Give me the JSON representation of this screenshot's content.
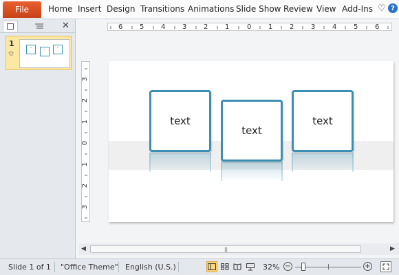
{
  "ribbon": {
    "file_label": "File",
    "tabs": [
      "Home",
      "Insert",
      "Design",
      "Transitions",
      "Animations",
      "Slide Show",
      "Review",
      "View",
      "Add-Ins"
    ],
    "help_label": "?"
  },
  "left_panel": {
    "slide_number": "1",
    "mini_box_glyph": "˅"
  },
  "ruler": {
    "horizontal": [
      "6",
      "5",
      "4",
      "3",
      "2",
      "1",
      "0",
      "1",
      "2",
      "3",
      "4",
      "5",
      "6"
    ],
    "vertical": [
      "3",
      "2",
      "1",
      "0",
      "1",
      "2",
      "3"
    ]
  },
  "slide": {
    "boxes": [
      {
        "text": "text"
      },
      {
        "text": "text"
      },
      {
        "text": "text"
      }
    ],
    "colors": {
      "box_border": "#3a8fb3",
      "band": "#efefef"
    }
  },
  "scrollbar": {
    "grip": "|||"
  },
  "status_bar": {
    "slide_info": "Slide 1 of 1",
    "theme": "\"Office Theme\"",
    "language": "English (U.S.)",
    "zoom": "32%",
    "zoom_level": 0.32,
    "views": [
      "normal-view-icon",
      "slide-sorter-icon",
      "reading-view-icon",
      "slide-show-icon"
    ]
  },
  "accent_colors": {
    "file_tab": "#d54c20",
    "view_active": "#fbd77c"
  }
}
